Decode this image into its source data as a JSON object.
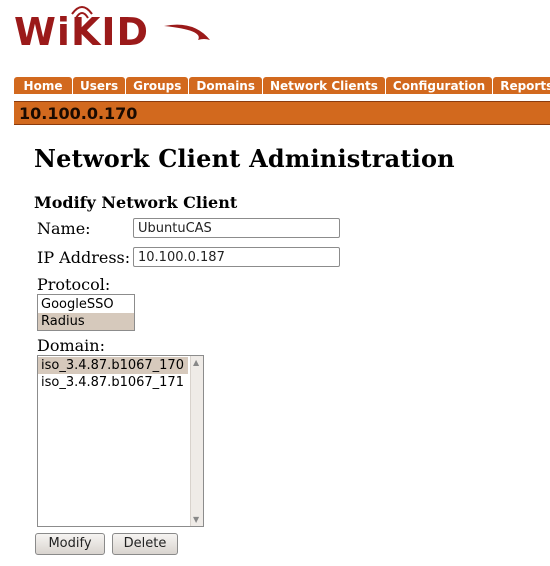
{
  "app": {
    "logo_text": "WiKID"
  },
  "nav": {
    "tabs": [
      "Home",
      "Users",
      "Groups",
      "Domains",
      "Network Clients",
      "Configuration",
      "Reports"
    ]
  },
  "server_bar": {
    "ip": "10.100.0.170"
  },
  "page": {
    "title": "Network Client Administration",
    "section_title": "Modify Network Client"
  },
  "form": {
    "name_label": "Name:",
    "name_value": "UbuntuCAS",
    "ip_label": "IP Address:",
    "ip_value": "10.100.0.187",
    "protocol_label": "Protocol:",
    "protocol_options": [
      "GoogleSSO",
      "Radius"
    ],
    "protocol_selected": "Radius",
    "domain_label": "Domain:",
    "domain_options": [
      "iso_3.4.87.b1067_170",
      "iso_3.4.87.b1067_171"
    ],
    "domain_selected": "iso_3.4.87.b1067_170",
    "modify_button": "Modify",
    "delete_button": "Delete"
  },
  "colors": {
    "tab_bg": "#d2691e",
    "logo": "#9b1a1a",
    "selected": "#d6c9bc"
  }
}
